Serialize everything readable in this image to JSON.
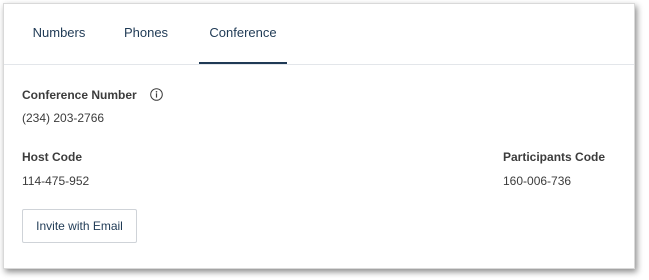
{
  "tabs": [
    {
      "label": "Numbers"
    },
    {
      "label": "Phones"
    },
    {
      "label": "Conference"
    }
  ],
  "active_tab": "Conference",
  "conference": {
    "number_label": "Conference Number",
    "number_value": "(234) 203-2766",
    "host_code_label": "Host Code",
    "host_code_value": "114-475-952",
    "participants_code_label": "Participants Code",
    "participants_code_value": "160-006-736",
    "invite_button_label": "Invite with Email"
  },
  "icons": {
    "info": "info-circle-icon"
  },
  "colors": {
    "tab_text": "#1f3a55",
    "active_underline": "#1f3a55",
    "body_text": "#3c3c3c",
    "divider": "#e3e6ea",
    "button_border": "#cfd3d8"
  }
}
